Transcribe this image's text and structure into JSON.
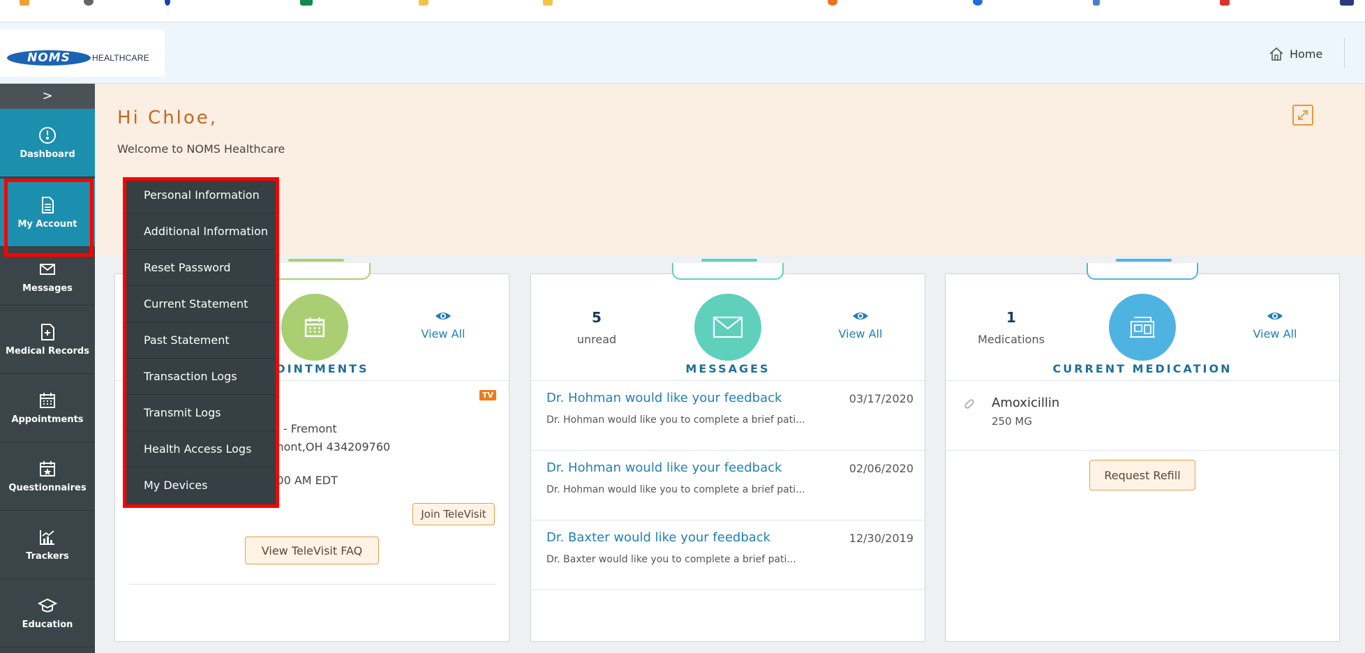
{
  "header": {
    "logo_main": "NOMS",
    "logo_sub": "HEALTHCARE",
    "home_label": "Home"
  },
  "sidebar": {
    "toggle": ">",
    "items": [
      {
        "label": "Dashboard",
        "icon": "dashboard-gauge-icon"
      },
      {
        "label": "My Account",
        "icon": "document-icon"
      },
      {
        "label": "Messages",
        "icon": "envelope-icon"
      },
      {
        "label": "Medical Records",
        "icon": "medical-records-icon"
      },
      {
        "label": "Appointments",
        "icon": "calendar-icon"
      },
      {
        "label": "Questionnaires",
        "icon": "calendar-star-icon"
      },
      {
        "label": "Trackers",
        "icon": "chart-icon"
      },
      {
        "label": "Education",
        "icon": "graduation-cap-icon"
      }
    ]
  },
  "account_menu": {
    "items": [
      "Personal Information",
      "Additional Information",
      "Reset Password",
      "Current Statement",
      "Past Statement",
      "Transaction Logs",
      "Transmit Logs",
      "Health Access Logs",
      "My Devices"
    ]
  },
  "banner": {
    "greeting": "Hi Chloe,",
    "welcome": "Welcome to NOMS Healthcare"
  },
  "appointments_card": {
    "title_visible": "OINTMENTS",
    "view_all": "View All",
    "tv_badge": "TV",
    "location_line": "e - Fremont",
    "address_line": "mont,OH 434209760",
    "time_line": ":00 AM EDT",
    "join_button": "Join TeleVisit",
    "faq_button": "View TeleVisit FAQ"
  },
  "messages_card": {
    "count": "5",
    "count_label": "unread",
    "view_all": "View All",
    "title": "MESSAGES",
    "messages": [
      {
        "title": "Dr. Hohman would like your feedback",
        "date": "03/17/2020",
        "body": "Dr. Hohman would like you to complete a brief pati..."
      },
      {
        "title": "Dr. Hohman would like your feedback",
        "date": "02/06/2020",
        "body": "Dr. Hohman would like you to complete a brief pati..."
      },
      {
        "title": "Dr. Baxter would like your feedback",
        "date": "12/30/2019",
        "body": "Dr. Baxter would like you to complete a brief pati..."
      }
    ]
  },
  "medication_card": {
    "count": "1",
    "count_label": "Medications",
    "view_all": "View All",
    "title": "CURRENT MEDICATION",
    "medication_name": "Amoxicillin",
    "medication_dose": "250 MG",
    "refill_button": "Request Refill"
  },
  "colors": {
    "sidebar_bg": "#3a4449",
    "sidebar_active": "#1d8fae",
    "highlight": "#ff0000",
    "banner_bg": "#fbeee3",
    "greeting": "#c06a1e",
    "appointments_circle": "#a9cf72",
    "messages_circle": "#5fd0bc",
    "medication_circle": "#4fb3e2",
    "link": "#1f7fb5"
  }
}
